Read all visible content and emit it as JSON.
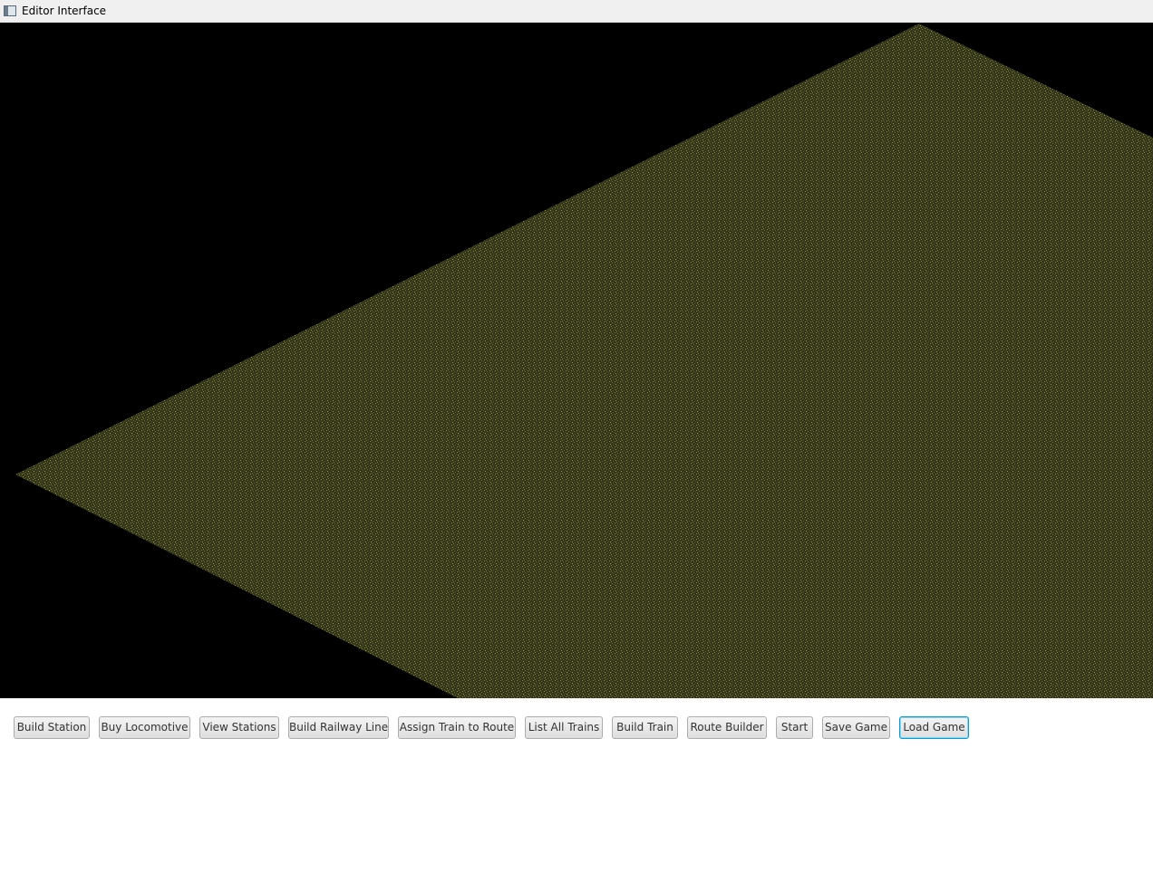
{
  "window": {
    "title": "Editor Interface",
    "icon": "app-window-icon"
  },
  "viewport": {
    "background_color": "#000000",
    "terrain_color": "#3a3a1c",
    "terrain_speckle_color": "#8a8a3a"
  },
  "toolbar": {
    "buttons": [
      {
        "label": "Build Station"
      },
      {
        "label": "Buy Locomotive"
      },
      {
        "label": "View Stations"
      },
      {
        "label": "Build Railway Line"
      },
      {
        "label": "Assign Train to Route"
      },
      {
        "label": "List All Trains"
      },
      {
        "label": "Build Train"
      },
      {
        "label": "Route Builder"
      },
      {
        "label": "Start"
      },
      {
        "label": "Save Game"
      },
      {
        "label": "Load Game",
        "focused": true
      }
    ],
    "focus_color": "#039ed3"
  }
}
